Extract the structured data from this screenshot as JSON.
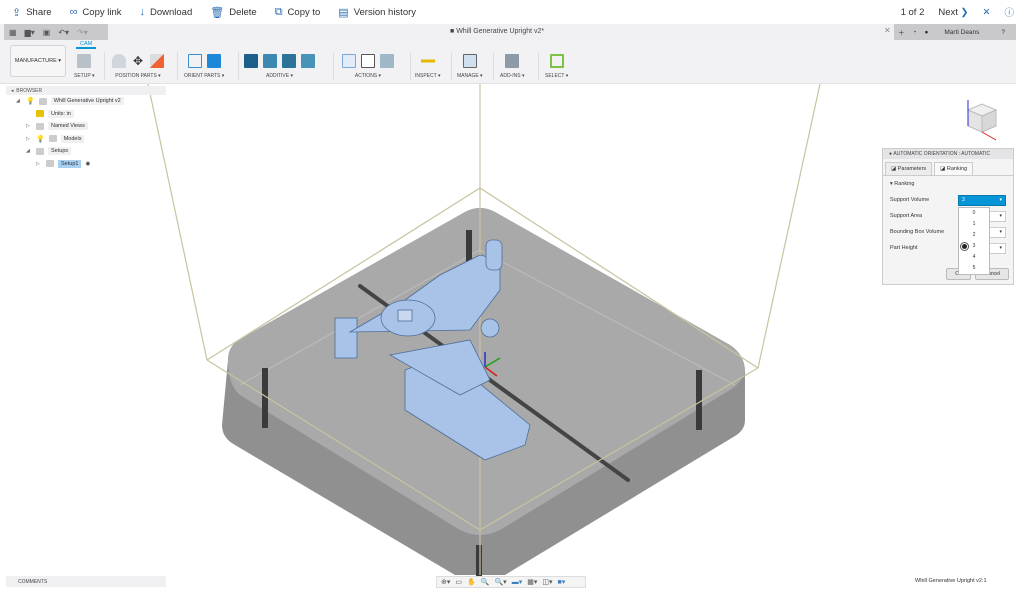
{
  "viewer_bar": {
    "share": "Share",
    "copy_link": "Copy link",
    "download": "Download",
    "delete": "Delete",
    "copy_to": "Copy to",
    "version_history": "Version history",
    "page_count": "1 of 2",
    "next": "Next"
  },
  "app": {
    "document_title": "Whill Generative Upright v2*",
    "user": "Marti Deans"
  },
  "toolbar": {
    "workspace": "MANUFACTURE",
    "tab": "CAM",
    "groups": [
      "SETUP",
      "POSITION PARTS",
      "ORIENT PARTS",
      "ADDITIVE",
      "ACTIONS",
      "INSPECT",
      "MANAGE",
      "ADD-INS",
      "SELECT"
    ]
  },
  "browser": {
    "header": "BROWSER",
    "root": "Whill Generative Upright v2",
    "units": "Units: in",
    "named_views": "Named Views",
    "models": "Models",
    "setups": "Setups",
    "setup1": "Setup1"
  },
  "comments": "COMMENTS",
  "status": "Whill Generative Upright v2:1",
  "dialog": {
    "title": "AUTOMATIC ORIENTATION : AUTOMATIC",
    "tabs": [
      "Parameters",
      "Ranking"
    ],
    "section": "Ranking",
    "fields": [
      {
        "label": "Support Volume",
        "value": "3"
      },
      {
        "label": "Support Area",
        "value": ""
      },
      {
        "label": "Bounding Box Volume",
        "value": ""
      },
      {
        "label": "Part Height",
        "value": ""
      }
    ],
    "dropdown_options": [
      "0",
      "1",
      "2",
      "3",
      "4",
      "5"
    ],
    "selected_option": "3",
    "ok": "OK",
    "cancel": "Cancel"
  },
  "colors": {
    "accent": "#0696d7",
    "part": "#a9c3e8",
    "plate": "#8c8c8c"
  }
}
